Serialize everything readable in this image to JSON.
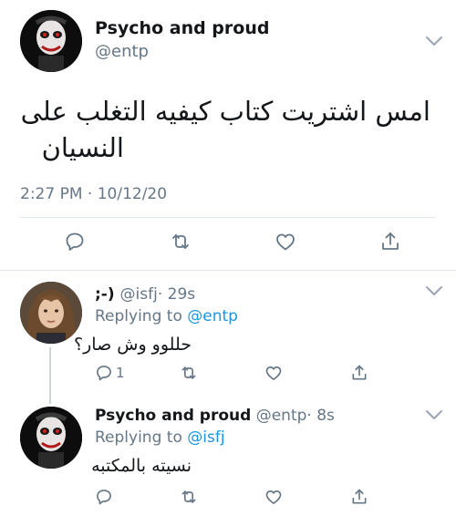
{
  "main_tweet": {
    "author_name": "Psycho and proud",
    "handle": "@entp",
    "text_line1": "امس اشتريت كتاب كيفيه التغلب على",
    "text_line2": "النسيان",
    "timestamp": "2:27 PM · 10/12/20"
  },
  "replies": [
    {
      "author_name": ";-) ",
      "handle": "@isfj",
      "time": "· 29s",
      "replying_label": "Replying to",
      "replying_to": "@entp",
      "text": "حللوو وش صار؟",
      "reply_count": "1"
    },
    {
      "author_name": "Psycho and proud",
      "handle": "@entp",
      "time": "· 8s",
      "replying_label": "Replying to",
      "replying_to": "@isfj",
      "text": "نسيته بالمكتبه",
      "reply_count": ""
    }
  ],
  "icons": {
    "reply": "reply-icon",
    "retweet": "retweet-icon",
    "like": "like-icon",
    "share": "share-icon",
    "more": "chevron-down-icon"
  },
  "colors": {
    "text": "#14171a",
    "secondary": "#657786",
    "link": "#1b95e0",
    "divider": "#e1e8ed"
  }
}
